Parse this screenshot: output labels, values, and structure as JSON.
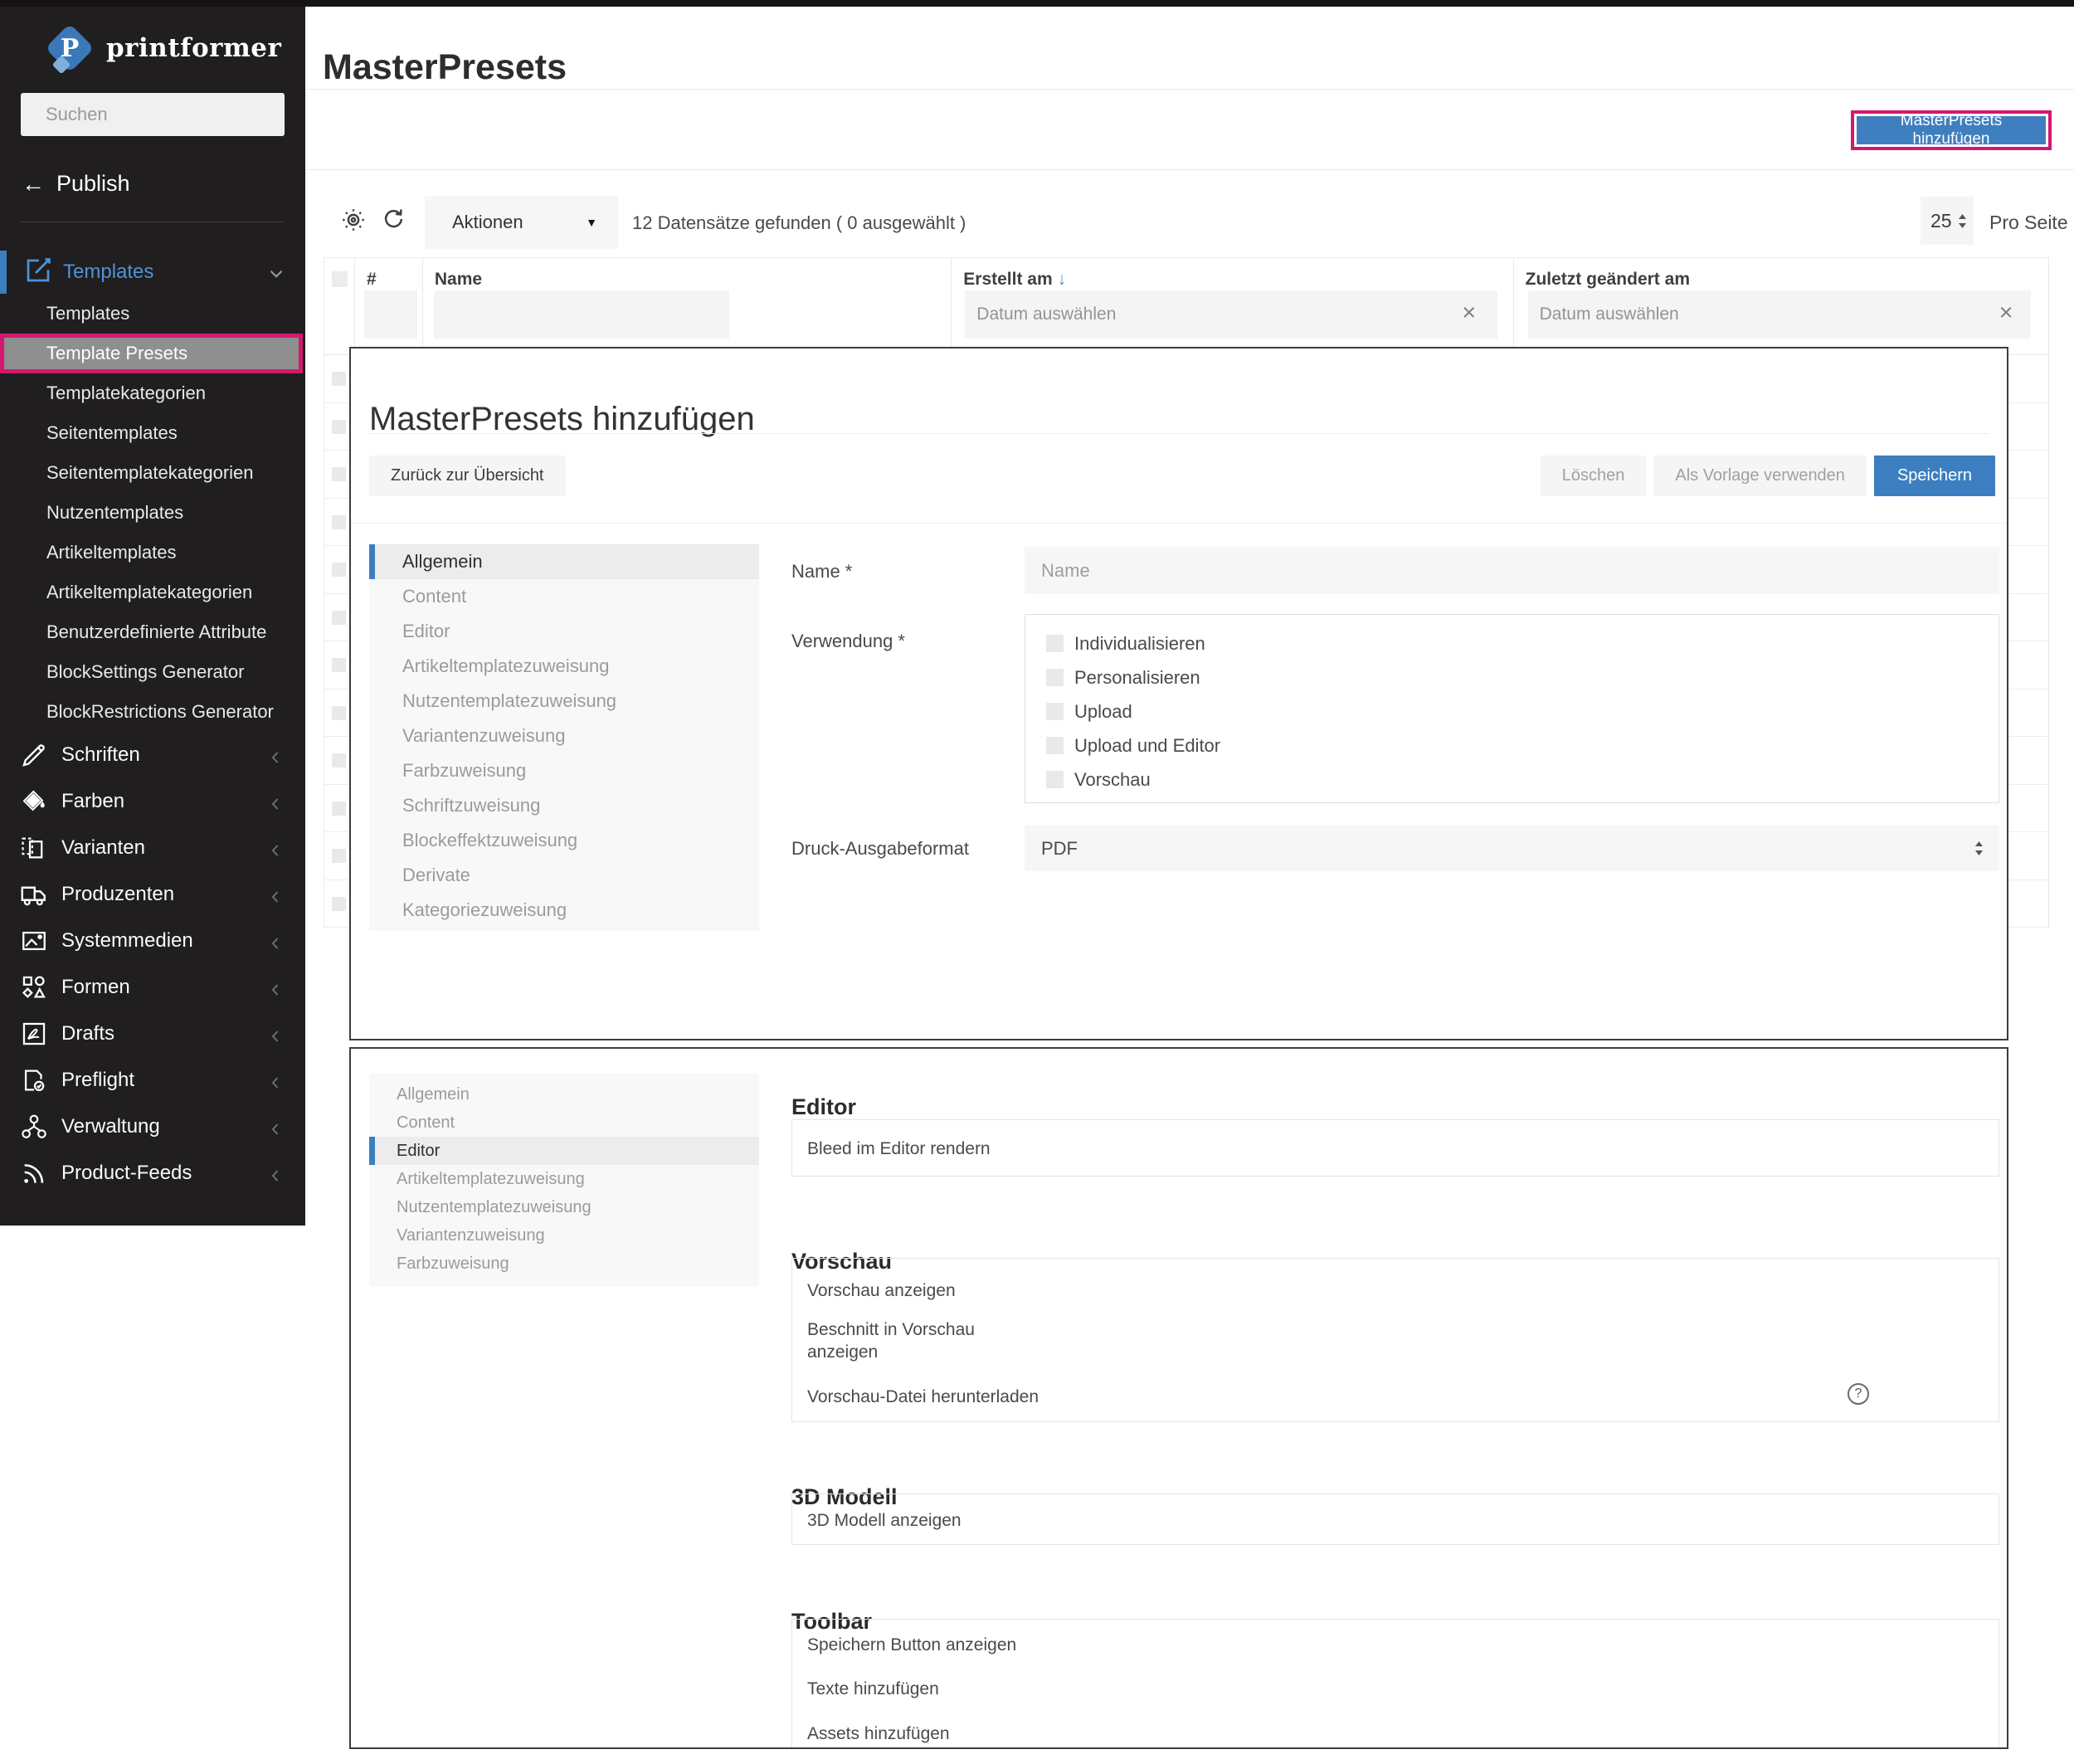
{
  "colors": {
    "accent": "#3b7ec2",
    "annotation": "#d2196e",
    "sidebar_bg": "#201e1e",
    "button_blue": "#3f7fc0"
  },
  "sidebar": {
    "logo_text": "printformer",
    "search_placeholder": "Suchen",
    "back_label": "Publish",
    "templates_menu": {
      "label": "Templates",
      "items": [
        {
          "label": "Templates"
        },
        {
          "label": "Template Presets",
          "highlighted": true
        },
        {
          "label": "Templatekategorien"
        },
        {
          "label": "Seitentemplates"
        },
        {
          "label": "Seitentemplatekategorien"
        },
        {
          "label": "Nutzentemplates"
        },
        {
          "label": "Artikeltemplates"
        },
        {
          "label": "Artikeltemplatekategorien"
        },
        {
          "label": "Benutzerdefinierte Attribute"
        },
        {
          "label": "BlockSettings Generator"
        },
        {
          "label": "BlockRestrictions Generator"
        }
      ]
    },
    "sections": [
      {
        "label": "Schriften",
        "icon": "pencil-icon"
      },
      {
        "label": "Farben",
        "icon": "paint-bucket-icon"
      },
      {
        "label": "Varianten",
        "icon": "pages-icon"
      },
      {
        "label": "Produzenten",
        "icon": "truck-icon"
      },
      {
        "label": "Systemmedien",
        "icon": "image-icon"
      },
      {
        "label": "Formen",
        "icon": "shapes-icon"
      },
      {
        "label": "Drafts",
        "icon": "pdf-icon"
      },
      {
        "label": "Preflight",
        "icon": "document-check-icon"
      },
      {
        "label": "Verwaltung",
        "icon": "org-chart-icon"
      },
      {
        "label": "Product-Feeds",
        "icon": "rss-icon"
      }
    ]
  },
  "header": {
    "title": "MasterPresets",
    "add_button_label": "MasterPresets hinzufügen"
  },
  "toolbar": {
    "actions_label": "Aktionen",
    "results_text": "12 Datensätze gefunden ( 0 ausgewählt )",
    "page_size_value": "25",
    "per_page_label": "Pro Seite"
  },
  "table": {
    "col_number": "#",
    "col_name": "Name",
    "col_created": "Erstellt am",
    "col_created_sort": "↓",
    "col_modified": "Zuletzt geändert am",
    "date_placeholder": "Datum auswählen",
    "rows_found": 12
  },
  "dialog": {
    "title": "MasterPresets hinzufügen",
    "back_button": "Zurück zur Übersicht",
    "delete_button": "Löschen",
    "template_button": "Als Vorlage verwenden",
    "save_button": "Speichern",
    "nav": {
      "active": "Allgemein",
      "items": [
        "Allgemein",
        "Content",
        "Editor",
        "Artikeltemplatezuweisung",
        "Nutzentemplatezuweisung",
        "Variantenzuweisung",
        "Farbzuweisung",
        "Schriftzuweisung",
        "Blockeffektzuweisung",
        "Derivate",
        "Kategoriezuweisung"
      ]
    },
    "form": {
      "name_label": "Name *",
      "name_placeholder": "Name",
      "usage_label": "Verwendung *",
      "usage_options": [
        {
          "label": "Individualisieren",
          "checked": false
        },
        {
          "label": "Personalisieren",
          "checked": false
        },
        {
          "label": "Upload",
          "checked": false
        },
        {
          "label": "Upload und Editor",
          "checked": false
        },
        {
          "label": "Vorschau",
          "checked": false
        }
      ],
      "print_format_label": "Druck-Ausgabeformat",
      "print_format_value": "PDF"
    }
  },
  "editor_panel": {
    "nav": {
      "active": "Editor",
      "items": [
        "Allgemein",
        "Content",
        "Editor",
        "Artikeltemplatezuweisung",
        "Nutzentemplatezuweisung",
        "Variantenzuweisung",
        "Farbzuweisung"
      ]
    },
    "sections": {
      "editor": {
        "heading": "Editor",
        "rows": [
          {
            "label": "Bleed im Editor rendern",
            "checked": true
          }
        ]
      },
      "vorschau": {
        "heading": "Vorschau",
        "rows": [
          {
            "label": "Vorschau anzeigen",
            "checked": true
          },
          {
            "label": "Beschnitt in Vorschau anzeigen",
            "checked": false
          },
          {
            "label": "Vorschau-Datei herunterladen",
            "checked": false,
            "extra_checked": true,
            "has_help": true
          }
        ]
      },
      "modell": {
        "heading": "3D Modell",
        "rows": [
          {
            "label": "3D Modell anzeigen",
            "checked": false
          }
        ]
      },
      "toolbar": {
        "heading": "Toolbar",
        "rows": [
          {
            "label": "Speichern Button anzeigen",
            "checked": false
          },
          {
            "label": "Texte hinzufügen",
            "checked": true
          },
          {
            "label": "Assets hinzufügen",
            "checked": true
          }
        ]
      }
    }
  }
}
